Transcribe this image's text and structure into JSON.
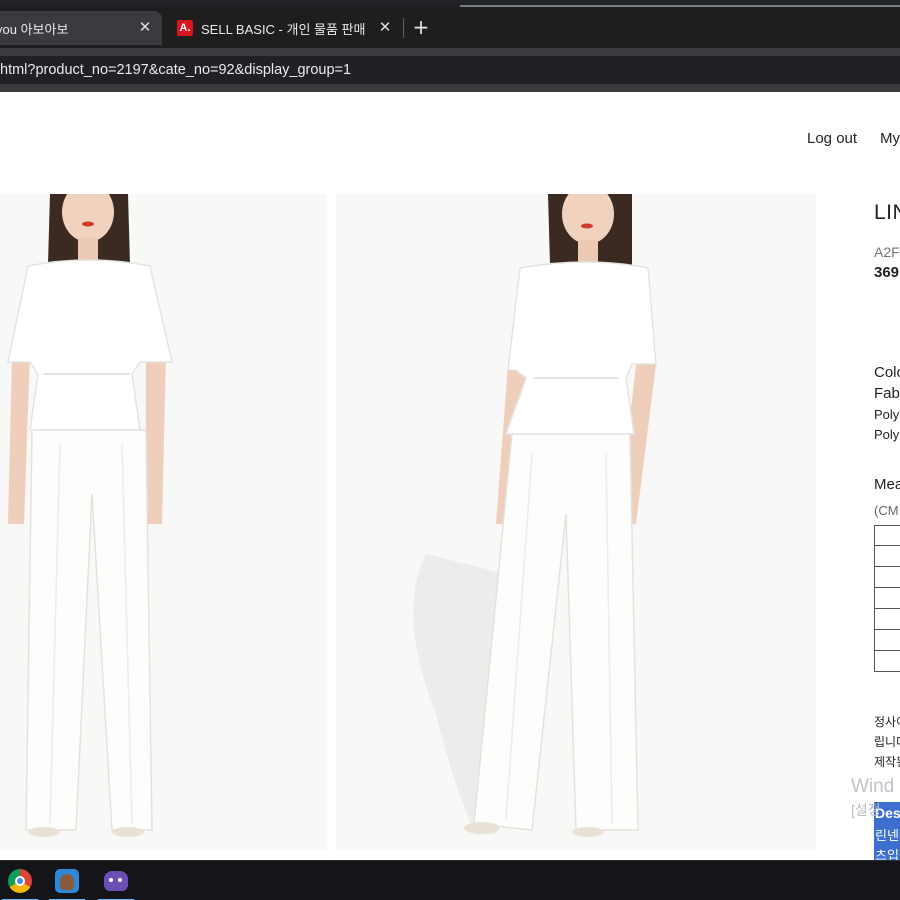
{
  "browser": {
    "tabs": [
      {
        "title": "you 아보아보",
        "close": "✕",
        "active": true
      },
      {
        "title": "SELL BASIC - 개인 물품 판매",
        "close": "✕",
        "active": false,
        "favicon": "A."
      }
    ],
    "new_tab": "+",
    "url": "html?product_no=2197&cate_no=92&display_group=1"
  },
  "site": {
    "nav": {
      "logout": "Log out",
      "my": "My"
    }
  },
  "product": {
    "name": "LIN",
    "code": "A2F",
    "price": "369",
    "color_label": "Colo",
    "fabric_label": "Fab",
    "fabric_lines": [
      "Poly",
      "Poly"
    ],
    "measure_label": "Mea",
    "unit_label": "(CM",
    "size_rows": 7,
    "description_lines": [
      "정사이",
      "립니다",
      "제작된"
    ],
    "selected_lines": [
      "Des",
      "린넨",
      "츠입"
    ]
  },
  "os": {
    "watermark_title": "Wind",
    "watermark_sub": "[설정",
    "taskbar": [
      "chrome-icon",
      "character-app-icon",
      "bot-app-icon"
    ]
  }
}
